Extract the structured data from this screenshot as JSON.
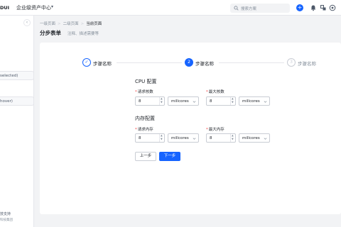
{
  "topbar": {
    "logo": "DUI",
    "app_title": "企业级资产中心",
    "search_placeholder": "搜索方案"
  },
  "sidebar": {
    "items": [
      {
        "label": "selected)"
      },
      {
        "label": "hover)"
      }
    ],
    "footer_line1": "技支持",
    "footer_line2": "科技集团"
  },
  "breadcrumb": {
    "items": [
      "一级页面",
      "二级页面",
      "当前页面"
    ],
    "separator": ">"
  },
  "page": {
    "title": "分步表单",
    "description": "注释、描述需要等"
  },
  "steps": [
    {
      "number": "✓",
      "label": "步骤名称",
      "status": "finished"
    },
    {
      "number": "2",
      "label": "步骤名称",
      "status": "active"
    },
    {
      "number": "3",
      "label": "步骤名称",
      "status": "waiting"
    }
  ],
  "form": {
    "cpu": {
      "title": "CPU 配置",
      "request_label": "请求核数",
      "request_value": "8",
      "request_unit": "millcores",
      "max_label": "最大核数",
      "max_value": "8",
      "max_unit": "millcores"
    },
    "memory": {
      "title": "内存配置",
      "request_label": "请求内存",
      "request_value": "8",
      "request_unit": "millcores",
      "max_label": "最大内存",
      "max_value": "8",
      "max_unit": "millcores"
    },
    "required_mark": "*",
    "prev_button": "上一步",
    "next_button": "下一步"
  },
  "colors": {
    "primary": "#1664ff",
    "required": "#f53f3f",
    "border": "#c9cdd4",
    "background": "#f2f3f5"
  }
}
